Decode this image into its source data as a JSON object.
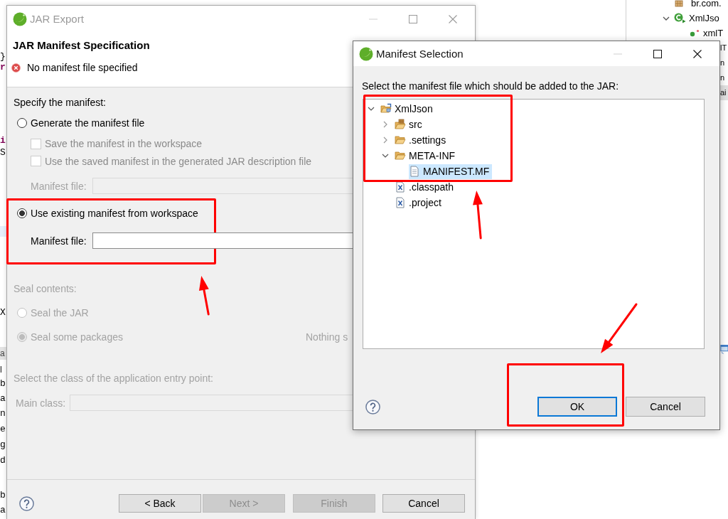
{
  "ide": {
    "editor_lines": [
      {
        "text": "}",
        "kind": "plain"
      },
      {
        "text": "r",
        "kind": "keyword"
      },
      {
        "text": "i",
        "kind": "keyword"
      },
      {
        "text": "S",
        "kind": "plain"
      },
      {
        "text": "X",
        "kind": "plain"
      }
    ],
    "view_tab": "a",
    "view_title": "l",
    "console_lines": [
      "b",
      "a",
      "n",
      "e",
      "g",
      "d",
      "b",
      "a"
    ],
    "outline": [
      {
        "label": "br.com.",
        "kind": "package"
      },
      {
        "label": "XmlJso",
        "kind": "class",
        "expanded": true
      },
      {
        "label": "xmlT",
        "kind": "field"
      }
    ],
    "outline_cut": [
      {
        "label": "lT",
        "selected": false
      },
      {
        "label": "n",
        "selected": false
      },
      {
        "label": "n",
        "selected": false
      },
      {
        "label": "ai",
        "selected": true
      }
    ]
  },
  "jar_export": {
    "title": "JAR Export",
    "active": false,
    "heading": "JAR Manifest Specification",
    "message": {
      "kind": "error",
      "text": "No manifest file specified"
    },
    "manifest_section": {
      "label": "Specify the manifest:",
      "items": [
        {
          "kind": "radio",
          "label": "Generate the manifest file",
          "selected": false,
          "disabled": false,
          "marked": false
        },
        {
          "kind": "checkbox",
          "label": "Save the manifest in the workspace",
          "checked": false,
          "disabled": true
        },
        {
          "kind": "checkbox",
          "label": "Use the saved manifest in the generated JAR description file",
          "checked": false,
          "disabled": true
        },
        {
          "kind": "field",
          "label": "Manifest file:",
          "disabled": true
        },
        {
          "kind": "radio",
          "label": "Use existing manifest from workspace",
          "selected": true,
          "disabled": false,
          "marked": true
        },
        {
          "kind": "field",
          "label": "Manifest file:",
          "disabled": false
        }
      ]
    },
    "seal_section": {
      "label": "Seal contents:",
      "disabled": true,
      "options": [
        {
          "label": "Seal the JAR",
          "selected": false,
          "disabled": true
        },
        {
          "label": "Seal some packages",
          "selected": true,
          "disabled": true
        }
      ],
      "note": "Nothing s"
    },
    "entry_point": {
      "label": "Select the class of the application entry point:",
      "disabled": true,
      "field_label": "Main class:"
    },
    "buttons": [
      {
        "label": "< Back",
        "disabled": false
      },
      {
        "label": "Next >",
        "disabled": true
      },
      {
        "label": "Finish",
        "disabled": true
      },
      {
        "label": "Cancel",
        "disabled": false
      }
    ]
  },
  "manifest_selection": {
    "title": "Manifest Selection",
    "active": true,
    "prompt": "Select the manifest file which should be added to the JAR:",
    "tree": {
      "marked": true,
      "nodes": [
        {
          "label": "XmlJson",
          "kind": "project",
          "expanded": true,
          "selected": false,
          "children": [
            {
              "label": "src",
              "kind": "package_folder",
              "expanded": false,
              "selected": false
            },
            {
              "label": ".settings",
              "kind": "folder",
              "expanded": false,
              "selected": false
            },
            {
              "label": "META-INF",
              "kind": "folder",
              "expanded": true,
              "selected": false,
              "children": [
                {
                  "label": "MANIFEST.MF",
                  "kind": "file",
                  "selected": true
                }
              ]
            },
            {
              "label": ".classpath",
              "kind": "xml_file",
              "selected": false
            },
            {
              "label": ".project",
              "kind": "xml_file",
              "selected": false
            }
          ]
        }
      ]
    },
    "buttons": [
      {
        "label": "OK",
        "default": true,
        "marked": true
      },
      {
        "label": "Cancel",
        "default": false,
        "marked": false
      }
    ]
  }
}
